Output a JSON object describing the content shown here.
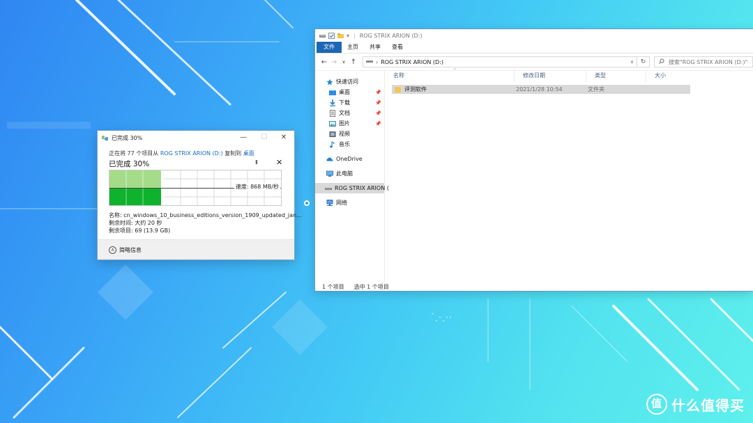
{
  "explorer": {
    "title": "ROG STRIX ARION (D:)",
    "ribbon_tabs": [
      "文件",
      "主页",
      "共享",
      "查看"
    ],
    "address": "ROG STRIX ARION (D:)",
    "search_placeholder": "搜索\"ROG STRIX ARION (D:)\"",
    "nav": {
      "quick_access": "快速访问",
      "items": [
        "桌面",
        "下载",
        "文档",
        "图片",
        "视频",
        "音乐"
      ],
      "onedrive": "OneDrive",
      "this_pc": "此电脑",
      "drive": "ROG STRIX ARION (",
      "network": "网络"
    },
    "columns": [
      "名称",
      "修改日期",
      "类型",
      "大小"
    ],
    "rows": [
      {
        "name": "评测软件",
        "date": "2021/1/28 10:54",
        "type": "文件夹",
        "size": ""
      }
    ],
    "status_count": "1 个项目",
    "status_selected": "选中 1 个项目"
  },
  "copy_dialog": {
    "title": "已完成 30%",
    "line_prefix": "正在将 77 个项目从",
    "source": "ROG STRIX ARION (D:)",
    "line_mid": "复制到",
    "dest": "桌面",
    "progress_label": "已完成 30%",
    "progress": 0.3,
    "speed": "速度: 868 MB/秒",
    "name_line": "名称: cn_windows_10_business_editions_version_1909_updated_jan...",
    "time_line": "剩余时间: 大约 20 秒",
    "items_line": "剩余项目: 69 (13.9 GB)",
    "details": "简略信息"
  },
  "watermark": {
    "logo": "值",
    "text": "什么值得买"
  },
  "colors": {
    "accent": "#1c67b5",
    "progress_light": "#a5dc89",
    "progress_dark": "#0eb22c",
    "link": "#1a69c4"
  }
}
